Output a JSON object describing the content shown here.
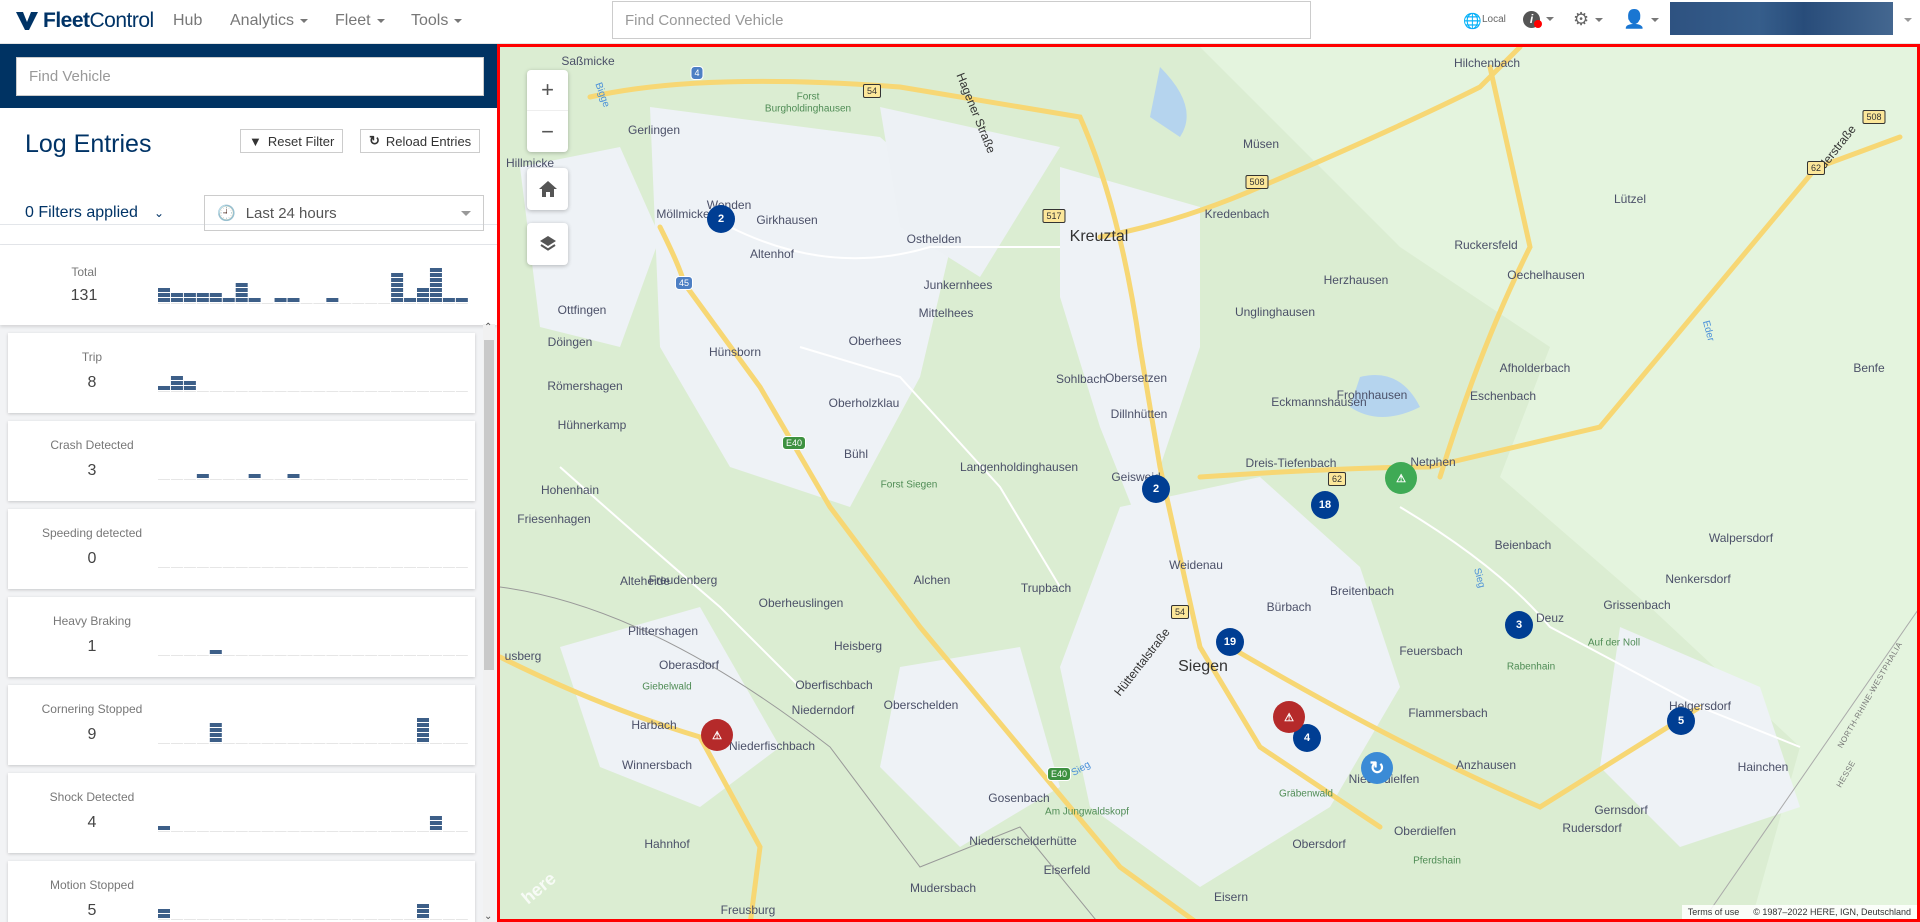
{
  "nav": {
    "brand_bold": "Fleet",
    "brand_light": "Control",
    "items": [
      "Hub",
      "Analytics",
      "Fleet",
      "Tools"
    ],
    "search_placeholder": "Find Connected Vehicle",
    "locale": "Local"
  },
  "sidebar": {
    "search_placeholder": "Find Vehicle",
    "title": "Log Entries",
    "reset_label": "Reset Filter",
    "reload_label": "Reload Entries",
    "filters_label": "0 Filters applied",
    "range_value": "Last 24 hours",
    "total": {
      "label": "Total",
      "count": "131",
      "hist": [
        3,
        2,
        2,
        2,
        2,
        1,
        4,
        1,
        0,
        1,
        1,
        0,
        0,
        1,
        0,
        0,
        0,
        0,
        6,
        1,
        3,
        7,
        1,
        1
      ]
    },
    "cards": [
      {
        "label": "Trip",
        "count": "8",
        "hist": [
          1,
          3,
          2,
          0,
          0,
          0,
          0,
          0,
          0,
          0,
          0,
          0,
          0,
          0,
          0,
          0,
          0,
          0,
          0,
          0,
          0,
          0,
          0,
          0
        ]
      },
      {
        "label": "Crash Detected",
        "count": "3",
        "hist": [
          0,
          0,
          0,
          1,
          0,
          0,
          0,
          1,
          0,
          0,
          1,
          0,
          0,
          0,
          0,
          0,
          0,
          0,
          0,
          0,
          0,
          0,
          0,
          0
        ]
      },
      {
        "label": "Speeding detected",
        "count": "0",
        "hist": [
          0,
          0,
          0,
          0,
          0,
          0,
          0,
          0,
          0,
          0,
          0,
          0,
          0,
          0,
          0,
          0,
          0,
          0,
          0,
          0,
          0,
          0,
          0,
          0
        ]
      },
      {
        "label": "Heavy Braking",
        "count": "1",
        "hist": [
          0,
          0,
          0,
          0,
          1,
          0,
          0,
          0,
          0,
          0,
          0,
          0,
          0,
          0,
          0,
          0,
          0,
          0,
          0,
          0,
          0,
          0,
          0,
          0
        ]
      },
      {
        "label": "Cornering Stopped",
        "count": "9",
        "hist": [
          0,
          0,
          0,
          0,
          4,
          0,
          0,
          0,
          0,
          0,
          0,
          0,
          0,
          0,
          0,
          0,
          0,
          0,
          0,
          0,
          5,
          0,
          0,
          0
        ]
      },
      {
        "label": "Shock Detected",
        "count": "4",
        "hist": [
          1,
          0,
          0,
          0,
          0,
          0,
          0,
          0,
          0,
          0,
          0,
          0,
          0,
          0,
          0,
          0,
          0,
          0,
          0,
          0,
          0,
          3,
          0,
          0
        ]
      },
      {
        "label": "Motion Stopped",
        "count": "5",
        "hist": [
          2,
          0,
          0,
          0,
          0,
          0,
          0,
          0,
          0,
          0,
          0,
          0,
          0,
          0,
          0,
          0,
          0,
          0,
          0,
          0,
          3,
          0,
          0,
          0
        ]
      }
    ]
  },
  "colors": {
    "brand": "#003366",
    "bar": "#3d5f88",
    "cluster": "#003e93",
    "alert_red": "#b52a2a",
    "alert_green": "#3faa55",
    "highlight": "#ff0000"
  },
  "map": {
    "places": [
      "Saßmicke",
      "Gerlingen",
      "Hillmicke",
      "Möllmicke",
      "Wenden",
      "Girkhausen",
      "Altenhof",
      "Osthelden",
      "Kreuztal",
      "Junkernhees",
      "Mittelhees",
      "Ottfingen",
      "Döingen",
      "Hünsborn",
      "Oberhees",
      "Römershagen",
      "Sohlbach",
      "Oberholzklau",
      "Hühnerkamp",
      "Dillnhütten",
      "Bühl",
      "Langenholdinghausen",
      "Geisweid",
      "Müsen",
      "Hilchenbach",
      "Kredenbach",
      "Herzhausen",
      "Ruckersfeld",
      "Oechelhausen",
      "Lützel",
      "Unglinghausen",
      "Afholderbach",
      "Benfe",
      "Frohnhausen",
      "Obersetzen",
      "Eckmannshausen",
      "Eschenbach",
      "Dreis-Tiefenbach",
      "Netphen",
      "Hohenhain",
      "Friesenhagen",
      "Freudenberg",
      "Alchen",
      "Alteheide",
      "Oberheuslingen",
      "Trupbach",
      "Weidenau",
      "Plittershagen",
      "usberg",
      "Heisberg",
      "Siegen",
      "Bürbach",
      "Breitenbach",
      "Feuersbach",
      "Beienbach",
      "Walpersdorf",
      "Nenkersdorf",
      "Grissenbach",
      "Deuz",
      "Oberasdorf",
      "Oberfischbach",
      "Niederndorf",
      "Oberschelden",
      "Harbach",
      "Niederfischbach",
      "Winnersbach",
      "Gosenbach",
      "Flammersbach",
      "Helgersdorf",
      "Anzhausen",
      "Hainchen",
      "Niederdielfen",
      "Hahnhof",
      "Niederschelderhütte",
      "Oberdielfen",
      "Rudersdorf",
      "Gernsdorf",
      "Obersdorf",
      "Eiserfeld",
      "Mudersbach",
      "Freusburg",
      "Eisern"
    ],
    "forests": [
      "Forst",
      "Burgholdinghausen",
      "Forst Siegen",
      "Giebelwald",
      "Auf der Noll",
      "Rabenhain",
      "Gräbenwald",
      "Am Jungwaldskopf",
      "Pferdshain"
    ],
    "streets": [
      "Hagener Straße",
      "Ederstraße",
      "Hüttentalstraße"
    ],
    "rivers": [
      "Bigge",
      "Sieg",
      "Sieg",
      "Eder"
    ],
    "borders": [
      "NORTH-RHINE-WESTPHALIA",
      "HESSE"
    ],
    "shields": [
      "4",
      "54",
      "517",
      "45",
      "E40",
      "508",
      "508",
      "62",
      "62",
      "54",
      "E40"
    ],
    "clusters": [
      "2",
      "2",
      "18",
      "19",
      "3",
      "4",
      "5"
    ],
    "attribution": {
      "terms": "Terms of use",
      "copyright": "© 1987–2022 HERE, IGN, Deutschland"
    },
    "watermark": "here"
  }
}
